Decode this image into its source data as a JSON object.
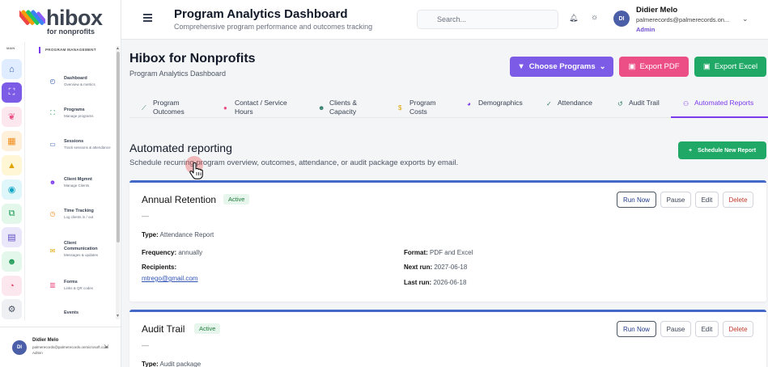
{
  "brand": {
    "word": "hibox",
    "sub": "for nonprofits",
    "colors": [
      "#ef4444",
      "#f59e0b",
      "#22c55e",
      "#3b82f6",
      "#8b5cf6",
      "#ec4899"
    ]
  },
  "rail": {
    "section": "MAIN",
    "icons": [
      {
        "name": "home-icon",
        "glyph": "⌂",
        "bg": "#e0ecff",
        "fg": "#2f54b5"
      },
      {
        "name": "hierarchy-icon",
        "glyph": "⛶",
        "bg": "#7c5ce6",
        "fg": "#ffffff"
      },
      {
        "name": "donation-icon",
        "glyph": "❦",
        "bg": "#fde7ef",
        "fg": "#ec4f86"
      },
      {
        "name": "building-icon",
        "glyph": "▦",
        "bg": "#fff0db",
        "fg": "#f08c1a"
      },
      {
        "name": "grad-cap-icon",
        "glyph": "▲",
        "bg": "#fff6d6",
        "fg": "#e0a400"
      },
      {
        "name": "cycle-icon",
        "glyph": "◉",
        "bg": "#dff6fb",
        "fg": "#0ea5c6"
      },
      {
        "name": "network-icon",
        "glyph": "⧉",
        "bg": "#e3f7ea",
        "fg": "#1e9a55"
      },
      {
        "name": "document-icon",
        "glyph": "▤",
        "bg": "#eae7fb",
        "fg": "#5b4bc4"
      },
      {
        "name": "people-icon",
        "glyph": "☻",
        "bg": "#e3f7ea",
        "fg": "#1e9a55"
      },
      {
        "name": "pie-icon",
        "glyph": "◔",
        "bg": "#fde7ef",
        "fg": "#e0365a"
      },
      {
        "name": "settings-icon",
        "glyph": "⚙",
        "bg": "#eef0f3",
        "fg": "#4b5563"
      }
    ]
  },
  "nav": {
    "section": "PROGRAM MANAGEMENT",
    "items": [
      {
        "title": "Dashboard",
        "sub": "Overview & metrics",
        "icon": "dashboard-icon",
        "glyph": "◴",
        "color": "#2f54b5"
      },
      {
        "title": "Programs",
        "sub": "Manage programs",
        "icon": "programs-icon",
        "glyph": "⛶",
        "color": "#1e9a55"
      },
      {
        "title": "Sessions",
        "sub": "Track sessions & attendance",
        "icon": "sessions-icon",
        "glyph": "▭",
        "color": "#2f54b5"
      },
      {
        "title": "Client Mgmnt",
        "sub": "Manage Clients",
        "icon": "clients-icon",
        "glyph": "☻",
        "color": "#7c3aed"
      },
      {
        "title": "Time Tracking",
        "sub": "Log clients in / out",
        "icon": "clock-icon",
        "glyph": "◷",
        "color": "#f08c1a"
      },
      {
        "title": "Client Communication",
        "sub": "Messages & updates",
        "icon": "chat-icon",
        "glyph": "✉",
        "color": "#e0a400"
      },
      {
        "title": "Forms",
        "sub": "Links & QR codes",
        "icon": "forms-icon",
        "glyph": "▥",
        "color": "#ec4f86"
      },
      {
        "title": "Events",
        "sub": "",
        "icon": "events-icon",
        "glyph": "",
        "color": "#374151"
      }
    ]
  },
  "user": {
    "initials": "DI",
    "name": "Didier Melo",
    "email": "palmerecords@palmerecords.onmicrosoft.com",
    "email_short": "palmerecords@palmerecords.on...",
    "role": "Admin"
  },
  "header": {
    "title": "Program Analytics Dashboard",
    "subtitle": "Comprehensive program performance and outcomes tracking",
    "search_placeholder": "Search..."
  },
  "page": {
    "title": "Hibox for Nonprofits",
    "subtitle": "Program Analytics Dashboard",
    "choose_label": "Choose Programs",
    "export_pdf": "Export PDF",
    "export_excel": "Export Excel"
  },
  "tabs": [
    {
      "l1": "Program",
      "l2": "Outcomes",
      "icon": "chart-line-icon",
      "glyph": "⟋"
    },
    {
      "l1": "Contact / Service",
      "l2": "Hours",
      "icon": "clock-tab-icon",
      "glyph": "●"
    },
    {
      "l1": "Clients &",
      "l2": "Capacity",
      "icon": "people-tab-icon",
      "glyph": "☻"
    },
    {
      "l1": "Program",
      "l2": "Costs",
      "icon": "dollar-icon",
      "glyph": "$"
    },
    {
      "l1": "Demographics",
      "l2": "",
      "icon": "pie-tab-icon",
      "glyph": "◕"
    },
    {
      "l1": "Attendance",
      "l2": "",
      "icon": "user-check-icon",
      "glyph": "✓"
    },
    {
      "l1": "Audit Trail",
      "l2": "",
      "icon": "history-icon",
      "glyph": "↺"
    },
    {
      "l1": "Automated Reports",
      "l2": "",
      "icon": "robot-icon",
      "glyph": "⚇"
    }
  ],
  "automated": {
    "title": "Automated reporting",
    "subtitle": "Schedule recurring program overview, outcomes, attendance, or audit package exports by email.",
    "schedule_button": "Schedule New Report"
  },
  "reports": [
    {
      "name": "Annual Retention",
      "status": "Active",
      "dash": "—",
      "type_label": "Type:",
      "type": "Attendance Report",
      "freq_label": "Frequency:",
      "freq": "annually",
      "recip_label": "Recipients:",
      "recipient": "mtrego@gmail.com",
      "format_label": "Format:",
      "format": "PDF and Excel",
      "next_label": "Next run:",
      "next": "2027-06-18",
      "last_label": "Last run:",
      "last": "2026-06-18"
    },
    {
      "name": "Audit Trail",
      "status": "Active",
      "dash": "—",
      "type_label": "Type:",
      "type": "Audit package"
    }
  ],
  "card_buttons": {
    "run": "Run Now",
    "pause": "Pause",
    "edit": "Edit",
    "delete": "Delete"
  }
}
